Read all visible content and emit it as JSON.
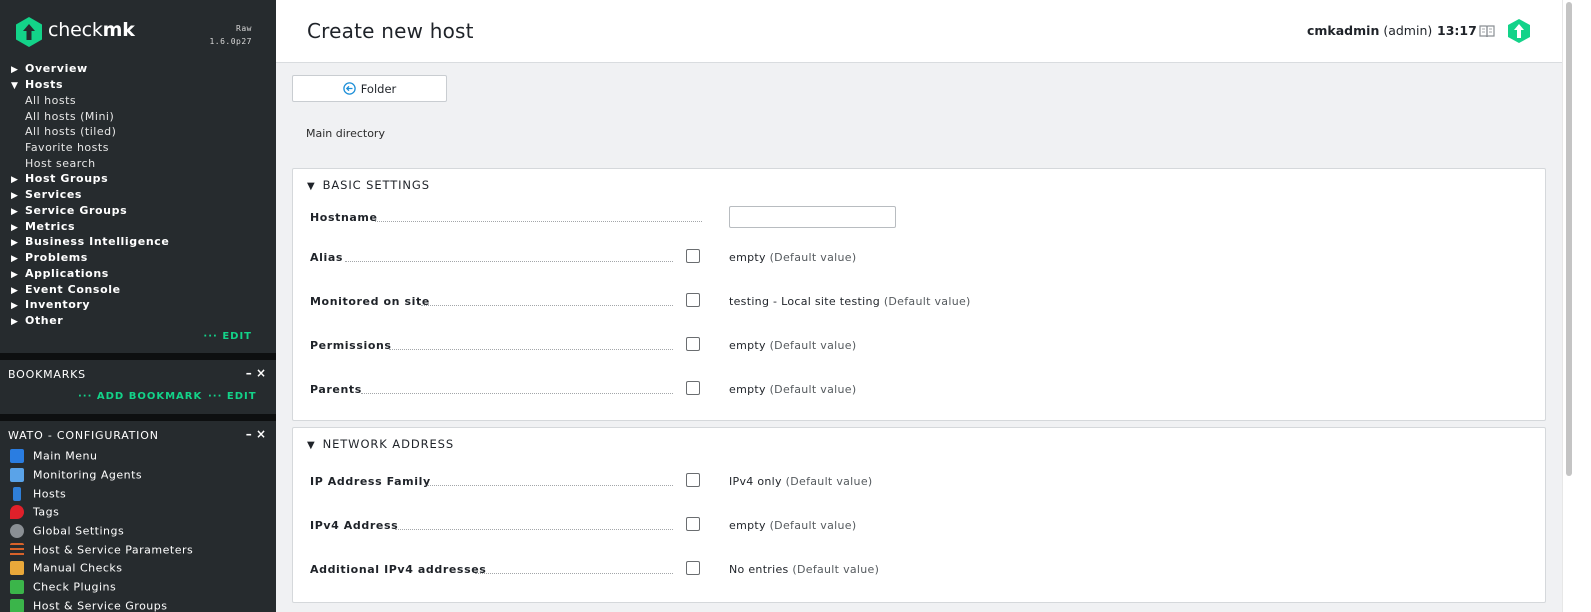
{
  "app": {
    "logo_text_prefix": "check",
    "logo_text_suffix": "mk",
    "edition_line1": "Raw",
    "edition_line2": "1.6.0p27",
    "accent_color": "#13d389"
  },
  "sidebar": {
    "views": {
      "items": [
        {
          "label": "Overview",
          "expanded": false
        },
        {
          "label": "Hosts",
          "expanded": true
        },
        {
          "label": "Host Groups",
          "expanded": false
        },
        {
          "label": "Services",
          "expanded": false
        },
        {
          "label": "Service Groups",
          "expanded": false
        },
        {
          "label": "Metrics",
          "expanded": false
        },
        {
          "label": "Business Intelligence",
          "expanded": false
        },
        {
          "label": "Problems",
          "expanded": false
        },
        {
          "label": "Applications",
          "expanded": false
        },
        {
          "label": "Event Console",
          "expanded": false
        },
        {
          "label": "Inventory",
          "expanded": false
        },
        {
          "label": "Other",
          "expanded": false
        }
      ],
      "hosts_subitems": [
        "All hosts",
        "All hosts (Mini)",
        "All hosts (tiled)",
        "Favorite hosts",
        "Host search"
      ],
      "edit_link": "EDIT"
    },
    "bookmarks": {
      "title": "BOOKMARKS",
      "add_link": "ADD BOOKMARK",
      "edit_link": "EDIT",
      "minimize": "–",
      "close": "×"
    },
    "wato": {
      "title": "WATO - CONFIGURATION",
      "minimize": "–",
      "close": "×",
      "items": [
        {
          "label": "Main Menu",
          "icon": "home-icon",
          "color": "#2a7de1"
        },
        {
          "label": "Monitoring Agents",
          "icon": "agent-icon",
          "color": "#5aa3e8"
        },
        {
          "label": "Hosts",
          "icon": "host-icon",
          "color": "#2f7fd8"
        },
        {
          "label": "Tags",
          "icon": "tag-icon",
          "color": "#e0202a"
        },
        {
          "label": "Global Settings",
          "icon": "gear-icon",
          "color": "#8a8f94"
        },
        {
          "label": "Host & Service Parameters",
          "icon": "rules-icon",
          "color": "#d8622a"
        },
        {
          "label": "Manual Checks",
          "icon": "hand-icon",
          "color": "#e9a83a"
        },
        {
          "label": "Check Plugins",
          "icon": "plugin-icon",
          "color": "#3bb54a"
        },
        {
          "label": "Host & Service Groups",
          "icon": "groups-icon",
          "color": "#3bb54a"
        }
      ]
    }
  },
  "header": {
    "title": "Create new host",
    "username": "cmkadmin",
    "role": "(admin)",
    "time": "13:17"
  },
  "content": {
    "folder_button": "Folder",
    "folder_path": "Main directory",
    "basic_settings": {
      "title": "BASIC SETTINGS",
      "hostname_label": "Hostname",
      "hostname_value": "",
      "rows": [
        {
          "label": "Alias",
          "value": "empty",
          "default": "(Default value)"
        },
        {
          "label": "Monitored on site",
          "value": "testing - Local site testing",
          "default": "(Default value)"
        },
        {
          "label": "Permissions",
          "value": "empty",
          "default": "(Default value)"
        },
        {
          "label": "Parents",
          "value": "empty",
          "default": "(Default value)"
        }
      ]
    },
    "network_address": {
      "title": "NETWORK ADDRESS",
      "rows": [
        {
          "label": "IP Address Family",
          "value": "IPv4 only",
          "default": "(Default value)"
        },
        {
          "label": "IPv4 Address",
          "value": "empty",
          "default": "(Default value)"
        },
        {
          "label": "Additional IPv4 addresses",
          "value": "No entries",
          "default": "(Default value)"
        }
      ]
    }
  }
}
